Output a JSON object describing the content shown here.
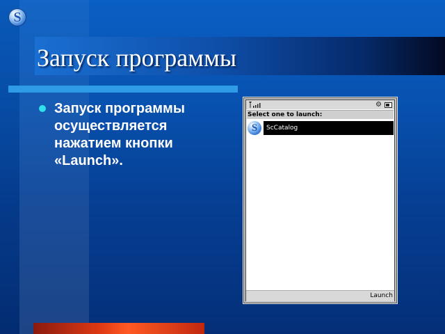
{
  "slide": {
    "title": "Запуск программы",
    "bullet": "Запуск программы осуществляется нажатием кнопки «Launch»."
  },
  "phone": {
    "header": "Select one to launch:",
    "items": [
      {
        "label": "ScCatalog",
        "icon": "scatalog-logo-icon",
        "selected": true
      }
    ],
    "softkey_right": "Launch",
    "status_icons": [
      "signal-icon",
      "gear-icon",
      "battery-icon"
    ]
  },
  "logo_letter": "S",
  "colors": {
    "background": "#0852b0",
    "accent_bar": "#2f9be6",
    "bullet": "#30e0ea",
    "bottom_bar": "#e03a14"
  }
}
